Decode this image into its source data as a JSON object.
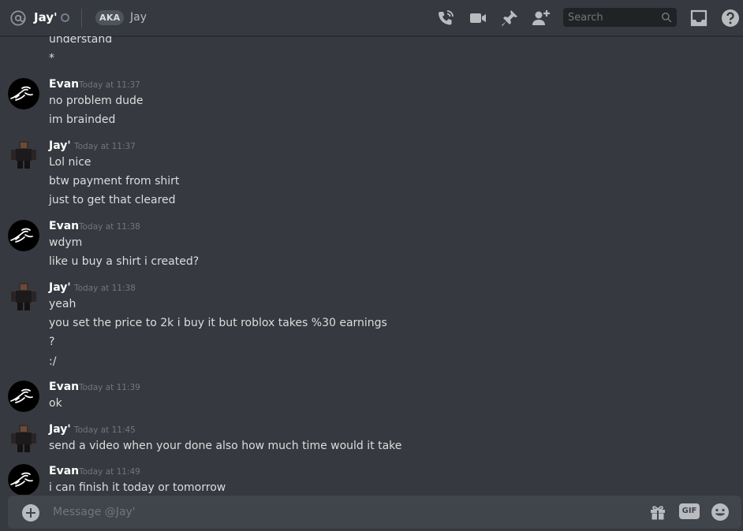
{
  "header": {
    "name": "Jay'",
    "aka_badge": "AKA",
    "aka_name": "Jay",
    "icons": [
      "at-icon",
      "phone-call-icon",
      "video-call-icon",
      "pin-icon",
      "add-friend-icon",
      "inbox-icon",
      "help-icon"
    ],
    "search_placeholder": "Search"
  },
  "colors": {
    "background": "#36393f",
    "composer": "#40444b",
    "username": "#ffffff",
    "timestamp": "#72767d",
    "text": "#dcddde"
  },
  "messages": {
    "top_fragment": [
      "understand",
      "*"
    ],
    "groups": [
      {
        "author": "Evan",
        "time": "Today at 11:37",
        "lines": [
          "no problem dude",
          "im brainded"
        ]
      },
      {
        "author": "Jay'",
        "time": "Today at 11:37",
        "lines": [
          "Lol nice",
          "btw payment from shirt",
          "just to get that cleared"
        ]
      },
      {
        "author": "Evan",
        "time": "Today at 11:38",
        "lines": [
          "wdym",
          "like u buy a shirt i created?"
        ]
      },
      {
        "author": "Jay'",
        "time": "Today at 11:38",
        "lines": [
          "yeah",
          "you set the price to 2k i buy it but roblox takes %30 earnings",
          "?",
          ":/"
        ]
      },
      {
        "author": "Evan",
        "time": "Today at 11:39",
        "lines": [
          "ok"
        ]
      },
      {
        "author": "Jay'",
        "time": "Today at 11:45",
        "lines": [
          "send a video when your done also how much time would it take"
        ]
      },
      {
        "author": "Evan",
        "time": "Today at 11:49",
        "lines": [
          "i can finish it today or tomorrow"
        ]
      }
    ]
  },
  "composer": {
    "placeholder": "Message @Jay'",
    "gif_label": "GIF",
    "icons": [
      "add-attachment-icon",
      "gift-icon",
      "gif-icon",
      "emoji-icon"
    ]
  }
}
